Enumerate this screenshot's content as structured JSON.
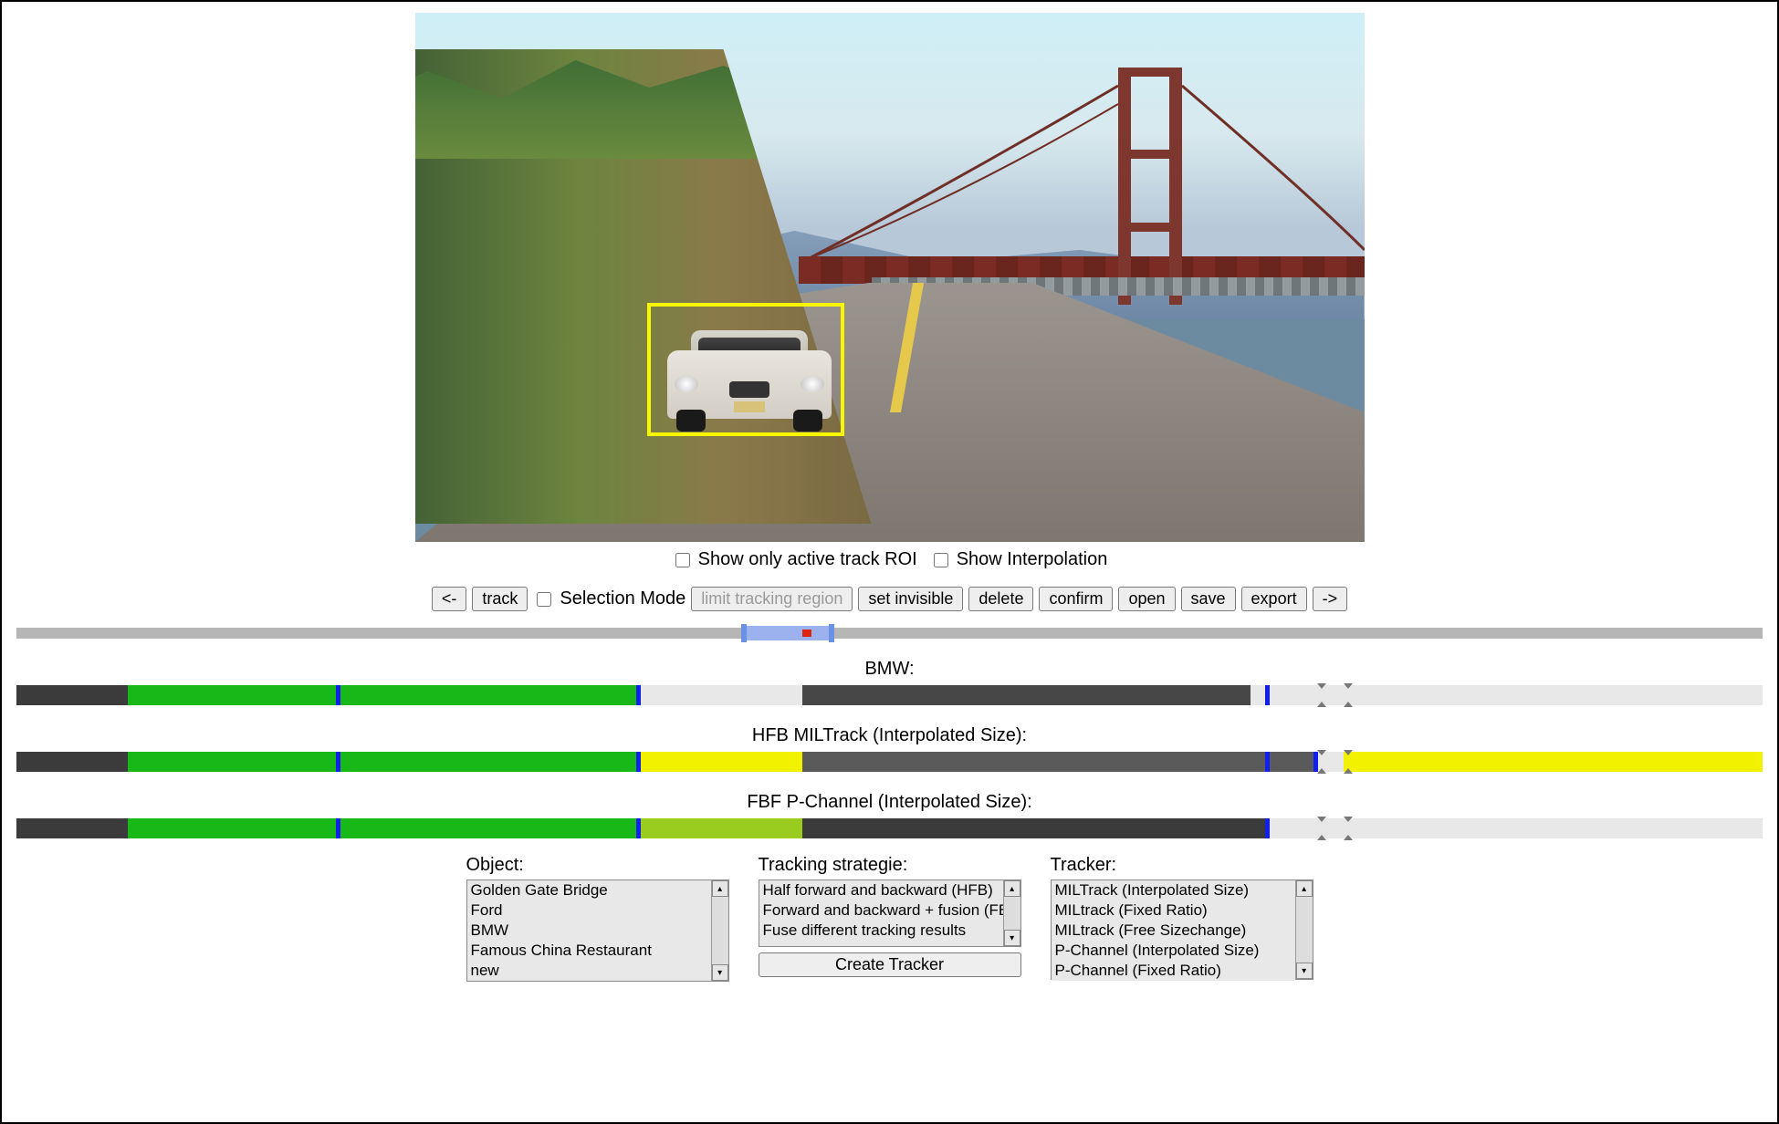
{
  "video": {
    "bbox_label": "car-bounding-box"
  },
  "checks": {
    "show_only_active_roi": "Show only active track ROI",
    "show_interpolation": "Show Interpolation"
  },
  "toolbar": {
    "prev": "<-",
    "track": "track",
    "selection_mode": "Selection Mode",
    "limit_region": "limit tracking region",
    "set_invisible": "set invisible",
    "delete": "delete",
    "confirm": "confirm",
    "open": "open",
    "save": "save",
    "export": "export",
    "next": "->"
  },
  "slider": {
    "range_start_pct": 41.5,
    "range_end_pct": 46.5,
    "dot_pct": 45.0
  },
  "tracks": [
    {
      "label": "BMW:",
      "segments": [
        {
          "start": 0,
          "end": 6.4,
          "color": "#3b3b3b"
        },
        {
          "start": 6.4,
          "end": 18.3,
          "color": "#18b818"
        },
        {
          "start": 18.3,
          "end": 35.5,
          "color": "#18b818"
        },
        {
          "start": 45.0,
          "end": 70.7,
          "color": "#474747"
        }
      ],
      "ticks_pct": [
        18.3,
        35.5,
        71.5
      ],
      "thumbs_pct": [
        74.5,
        76.0
      ]
    },
    {
      "label": "HFB MILTrack (Interpolated Size):",
      "segments": [
        {
          "start": 0,
          "end": 6.4,
          "color": "#3b3b3b"
        },
        {
          "start": 6.4,
          "end": 18.3,
          "color": "#18b818"
        },
        {
          "start": 18.3,
          "end": 35.5,
          "color": "#18b818"
        },
        {
          "start": 35.5,
          "end": 45.0,
          "color": "#f2f200"
        },
        {
          "start": 45.0,
          "end": 71.5,
          "color": "#5a5a5a"
        },
        {
          "start": 71.5,
          "end": 74.3,
          "color": "#5a5a5a"
        },
        {
          "start": 76.0,
          "end": 100.0,
          "color": "#f2f200"
        }
      ],
      "ticks_pct": [
        18.3,
        35.5,
        71.5,
        74.3
      ],
      "thumbs_pct": [
        74.5,
        76.0
      ]
    },
    {
      "label": "FBF P-Channel (Interpolated Size):",
      "segments": [
        {
          "start": 0,
          "end": 6.4,
          "color": "#3b3b3b"
        },
        {
          "start": 6.4,
          "end": 18.3,
          "color": "#18b818"
        },
        {
          "start": 18.3,
          "end": 35.5,
          "color": "#18b818"
        },
        {
          "start": 35.5,
          "end": 45.0,
          "color": "#9acc20"
        },
        {
          "start": 45.0,
          "end": 71.5,
          "color": "#3b3b3b"
        }
      ],
      "ticks_pct": [
        18.3,
        35.5,
        71.5
      ],
      "thumbs_pct": [
        74.5,
        76.0
      ]
    }
  ],
  "panels": {
    "object": {
      "label": "Object:",
      "options": [
        "Golden Gate Bridge",
        "Ford",
        "BMW",
        "Famous China Restaurant",
        "new"
      ]
    },
    "strategy": {
      "label": "Tracking strategie:",
      "options": [
        "Half forward and backward (HFB)",
        "Forward and backward + fusion (FBF)",
        "Fuse different tracking results"
      ],
      "button": "Create Tracker"
    },
    "tracker": {
      "label": "Tracker:",
      "options": [
        "MILTrack (Interpolated Size)",
        "MILtrack (Fixed Ratio)",
        "MILtrack (Free Sizechange)",
        "P-Channel (Interpolated Size)",
        "P-Channel (Fixed Ratio)"
      ]
    }
  }
}
